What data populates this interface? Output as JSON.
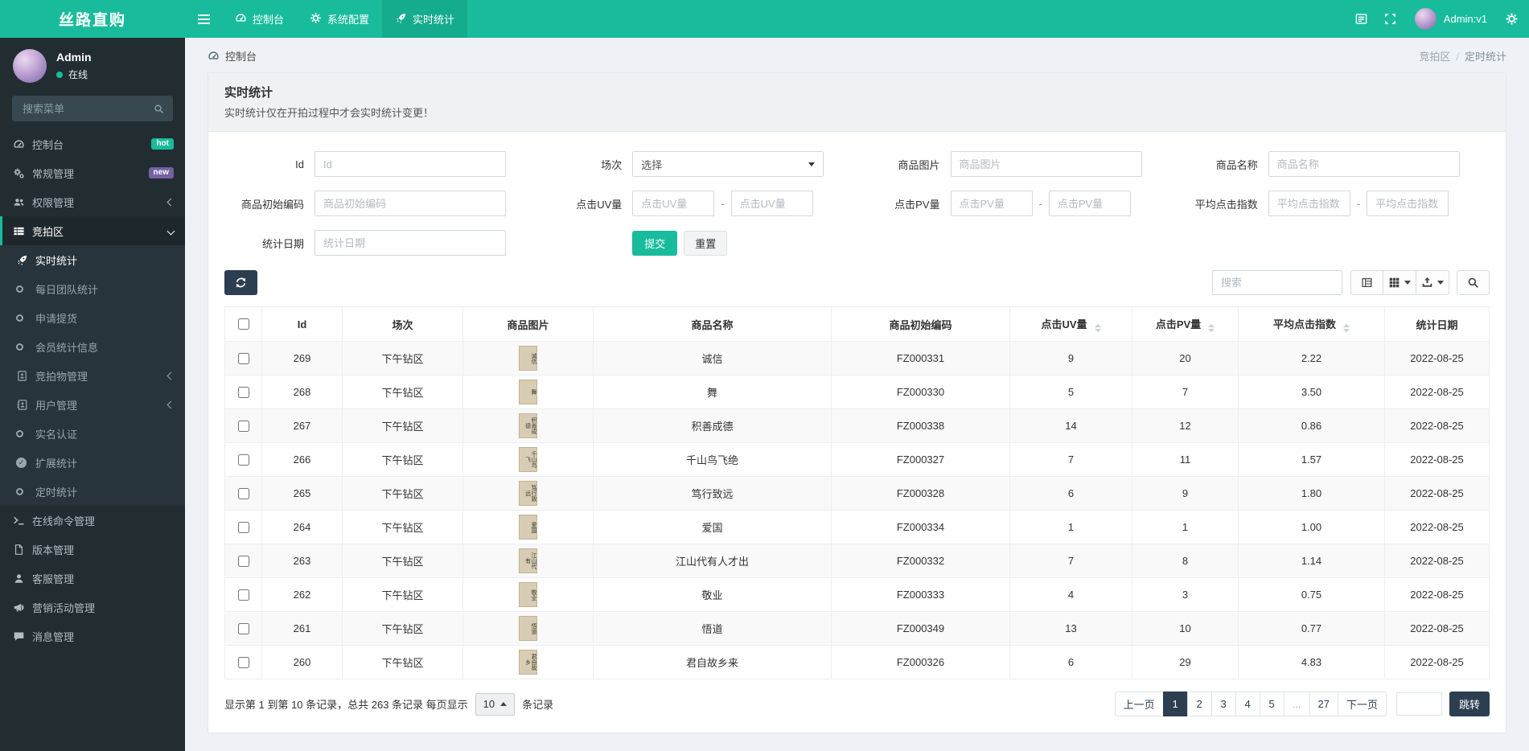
{
  "theme": {
    "accent": "#18bc9c",
    "navbar_bg": "#18bc9c",
    "sidebar_bg": "#222d32",
    "submenu_bg": "#28343b",
    "dark_button": "#2c3e50",
    "content_bg": "#eef2f6",
    "stripe_row": "#f9f9f9",
    "badge_hot": "#18bc9c",
    "badge_new": "#7460a3"
  },
  "brand": "丝路直购",
  "topnav": {
    "items": [
      {
        "label": "控制台",
        "icon": "dashboard",
        "active": false
      },
      {
        "label": "系统配置",
        "icon": "gear",
        "active": false
      },
      {
        "label": "实时统计",
        "icon": "rocket",
        "active": true
      }
    ]
  },
  "navbar_right": {
    "user_label": "Admin:v1"
  },
  "sidebar": {
    "user": {
      "name": "Admin",
      "status_label": "在线"
    },
    "search_placeholder": "搜索菜单",
    "menu": [
      {
        "label": "控制台",
        "icon": "dashboard",
        "badge": "hot",
        "badge_class": "hot"
      },
      {
        "label": "常规管理",
        "icon": "gears",
        "badge": "new",
        "badge_class": "new"
      },
      {
        "label": "权限管理",
        "icon": "users",
        "chevron": "left"
      },
      {
        "label": "竞拍区",
        "icon": "thlist",
        "active": true,
        "chevron": "down",
        "children": [
          {
            "label": "实时统计",
            "icon": "rocket",
            "active": true
          },
          {
            "label": "每日团队统计",
            "icon": "circle"
          },
          {
            "label": "申请提货",
            "icon": "circle"
          },
          {
            "label": "会员统计信息",
            "icon": "circle"
          },
          {
            "label": "竞拍物管理",
            "icon": "badge",
            "chevron": "left"
          },
          {
            "label": "用户管理",
            "icon": "addressbook",
            "chevron": "left"
          },
          {
            "label": "实名认证",
            "icon": "circle"
          },
          {
            "label": "扩展统计",
            "icon": "checkcircle"
          },
          {
            "label": "定时统计",
            "icon": "circle"
          }
        ]
      },
      {
        "label": "在线命令管理",
        "icon": "terminal"
      },
      {
        "label": "版本管理",
        "icon": "file"
      },
      {
        "label": "客服管理",
        "icon": "person"
      },
      {
        "label": "营销活动管理",
        "icon": "megaphone"
      },
      {
        "label": "消息管理",
        "icon": "comment"
      }
    ]
  },
  "breadcrumb": {
    "left_label": "控制台",
    "right": [
      "竞拍区",
      "定时统计"
    ]
  },
  "panel": {
    "title": "实时统计",
    "subtitle": "实时统计仅在开拍过程中才会实时统计变更！"
  },
  "filter": {
    "fields": [
      {
        "label": "Id",
        "type": "text",
        "placeholder": "Id"
      },
      {
        "label": "场次",
        "type": "select",
        "value": "选择"
      },
      {
        "label": "商品图片",
        "type": "text",
        "placeholder": "商品图片"
      },
      {
        "label": "商品名称",
        "type": "text",
        "placeholder": "商品名称"
      },
      {
        "label": "商品初始编码",
        "type": "text",
        "placeholder": "商品初始编码"
      },
      {
        "label": "点击UV量",
        "type": "range",
        "placeholder": "点击UV量"
      },
      {
        "label": "点击PV量",
        "type": "range",
        "placeholder": "点击PV量"
      },
      {
        "label": "平均点击指数",
        "type": "range",
        "placeholder": "平均点击指数"
      },
      {
        "label": "统计日期",
        "type": "text",
        "placeholder": "统计日期"
      }
    ],
    "submit_label": "提交",
    "reset_label": "重置"
  },
  "toolbar": {
    "search_placeholder": "搜索"
  },
  "table": {
    "columns": [
      {
        "label": "Id"
      },
      {
        "label": "场次"
      },
      {
        "label": "商品图片"
      },
      {
        "label": "商品名称"
      },
      {
        "label": "商品初始编码"
      },
      {
        "label": "点击UV量",
        "sortable": true
      },
      {
        "label": "点击PV量",
        "sortable": true
      },
      {
        "label": "平均点击指数",
        "sortable": true
      },
      {
        "label": "统计日期"
      }
    ],
    "rows": [
      {
        "id": "269",
        "session": "下午钻区",
        "name": "诚信",
        "code": "FZ000331",
        "uv": "9",
        "pv": "20",
        "avg": "2.22",
        "date": "2022-08-25"
      },
      {
        "id": "268",
        "session": "下午钻区",
        "name": "舞",
        "code": "FZ000330",
        "uv": "5",
        "pv": "7",
        "avg": "3.50",
        "date": "2022-08-25"
      },
      {
        "id": "267",
        "session": "下午钻区",
        "name": "积善成德",
        "code": "FZ000338",
        "uv": "14",
        "pv": "12",
        "avg": "0.86",
        "date": "2022-08-25"
      },
      {
        "id": "266",
        "session": "下午钻区",
        "name": "千山鸟飞绝",
        "code": "FZ000327",
        "uv": "7",
        "pv": "11",
        "avg": "1.57",
        "date": "2022-08-25"
      },
      {
        "id": "265",
        "session": "下午钻区",
        "name": "笃行致远",
        "code": "FZ000328",
        "uv": "6",
        "pv": "9",
        "avg": "1.80",
        "date": "2022-08-25"
      },
      {
        "id": "264",
        "session": "下午钻区",
        "name": "爱国",
        "code": "FZ000334",
        "uv": "1",
        "pv": "1",
        "avg": "1.00",
        "date": "2022-08-25"
      },
      {
        "id": "263",
        "session": "下午钻区",
        "name": "江山代有人才出",
        "code": "FZ000332",
        "uv": "7",
        "pv": "8",
        "avg": "1.14",
        "date": "2022-08-25"
      },
      {
        "id": "262",
        "session": "下午钻区",
        "name": "敬业",
        "code": "FZ000333",
        "uv": "4",
        "pv": "3",
        "avg": "0.75",
        "date": "2022-08-25"
      },
      {
        "id": "261",
        "session": "下午钻区",
        "name": "悟道",
        "code": "FZ000349",
        "uv": "13",
        "pv": "10",
        "avg": "0.77",
        "date": "2022-08-25"
      },
      {
        "id": "260",
        "session": "下午钻区",
        "name": "君自故乡来",
        "code": "FZ000326",
        "uv": "6",
        "pv": "29",
        "avg": "4.83",
        "date": "2022-08-25"
      }
    ]
  },
  "footer": {
    "info_part1": "显示第 1 到第 10 条记录，总共 263 条记录 每页显示",
    "page_size": "10",
    "info_part2": "条记录",
    "pagination": {
      "prev": "上一页",
      "pages": [
        "1",
        "2",
        "3",
        "4",
        "5",
        "...",
        "27"
      ],
      "active": "1",
      "next": "下一页",
      "jump_label": "跳转"
    }
  }
}
